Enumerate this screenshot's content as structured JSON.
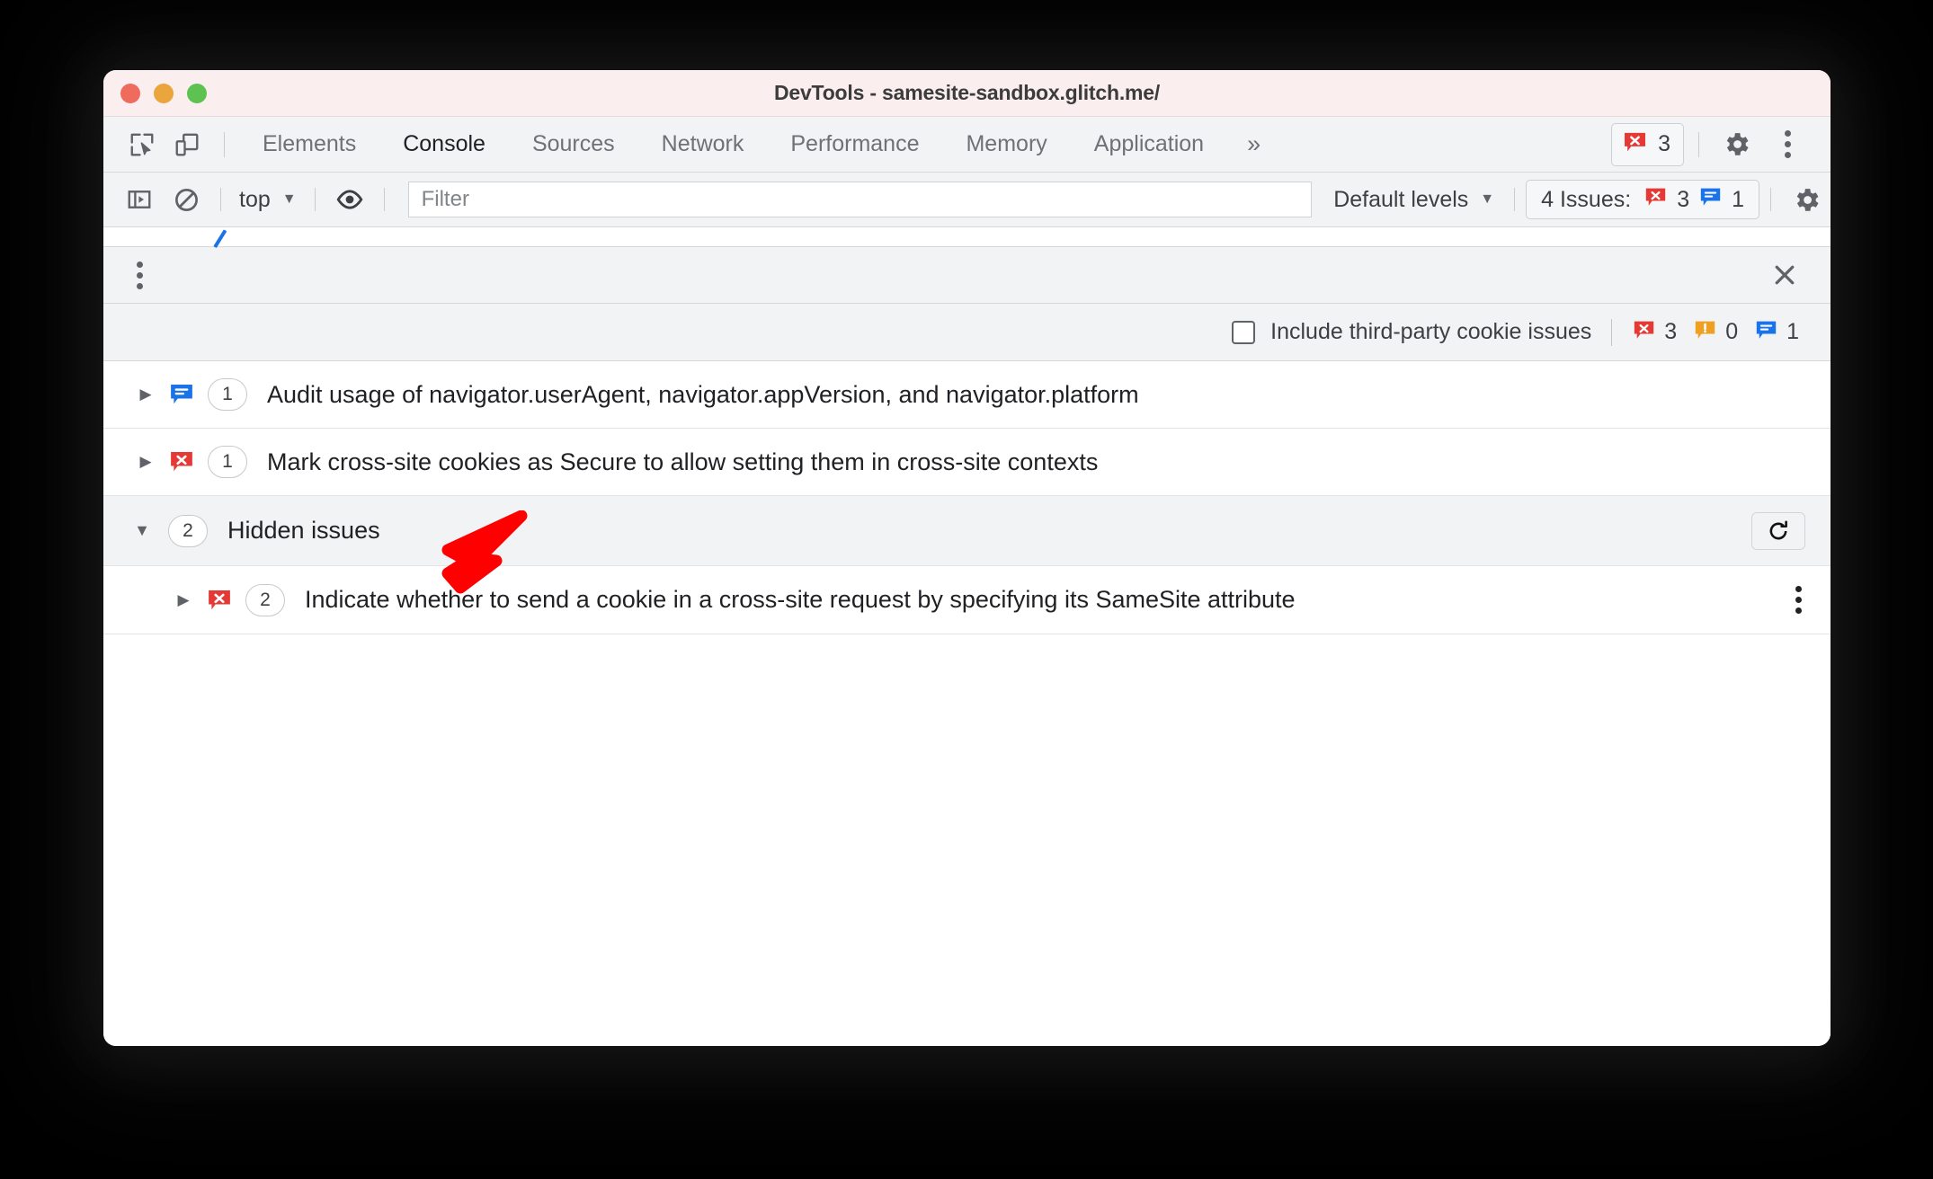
{
  "window": {
    "title": "DevTools - samesite-sandbox.glitch.me/",
    "traffic_lights": [
      "close",
      "minimize",
      "zoom"
    ]
  },
  "tabbar": {
    "left_icons": [
      "inspect-element-icon",
      "device-toolbar-icon"
    ],
    "tabs": [
      {
        "label": "Elements",
        "active": false
      },
      {
        "label": "Console",
        "active": true
      },
      {
        "label": "Sources",
        "active": false
      },
      {
        "label": "Network",
        "active": false
      },
      {
        "label": "Performance",
        "active": false
      },
      {
        "label": "Memory",
        "active": false
      },
      {
        "label": "Application",
        "active": false
      }
    ],
    "more_tabs": "»",
    "error_pill": {
      "icon": "error-icon",
      "count": "3"
    },
    "settings_icon": "gear-icon",
    "menu_icon": "kebab-icon"
  },
  "filterbar": {
    "sidebar_toggle_icon": "console-sidebar-icon",
    "clear_icon": "clear-console-icon",
    "context": "top",
    "context_caret": "▼",
    "eye_icon": "live-expression-icon",
    "filter_placeholder": "Filter",
    "filter_value": "",
    "levels_label": "Default levels",
    "levels_caret": "▼",
    "issues_pill": {
      "label": "4 Issues:",
      "error_count": "3",
      "info_count": "1"
    },
    "settings_icon": "gear-icon"
  },
  "drawer": {
    "menu_icon": "kebab-icon",
    "close_icon": "close-icon"
  },
  "third_party": {
    "checkbox_checked": false,
    "label": "Include third-party cookie issues",
    "counts": {
      "errors": "3",
      "warnings": "0",
      "infos": "1"
    }
  },
  "issues": [
    {
      "expanded": false,
      "triangle": "▶",
      "kind": "info",
      "count": "1",
      "title": "Audit usage of navigator.userAgent, navigator.appVersion, and navigator.platform"
    },
    {
      "expanded": false,
      "triangle": "▶",
      "kind": "error",
      "count": "1",
      "title": "Mark cross-site cookies as Secure to allow setting them in cross-site contexts"
    }
  ],
  "hidden_group": {
    "expanded": true,
    "triangle": "▼",
    "count": "2",
    "title": "Hidden issues",
    "refresh_icon": "refresh-icon",
    "children": [
      {
        "triangle": "▶",
        "kind": "error",
        "count": "2",
        "title": "Indicate whether to send a cookie in a cross-site request by specifying its SameSite attribute",
        "menu_icon": "kebab-icon"
      }
    ]
  },
  "annotation": {
    "arrow_color": "#ff0000",
    "points_at": "Hidden issues"
  },
  "colors": {
    "titlebar_bg": "#fbeeee",
    "toolbar_bg": "#f1f3f4",
    "error_red": "#e53935",
    "warning_orange": "#f0a020",
    "info_blue": "#1a73e8",
    "text": "#202124"
  }
}
